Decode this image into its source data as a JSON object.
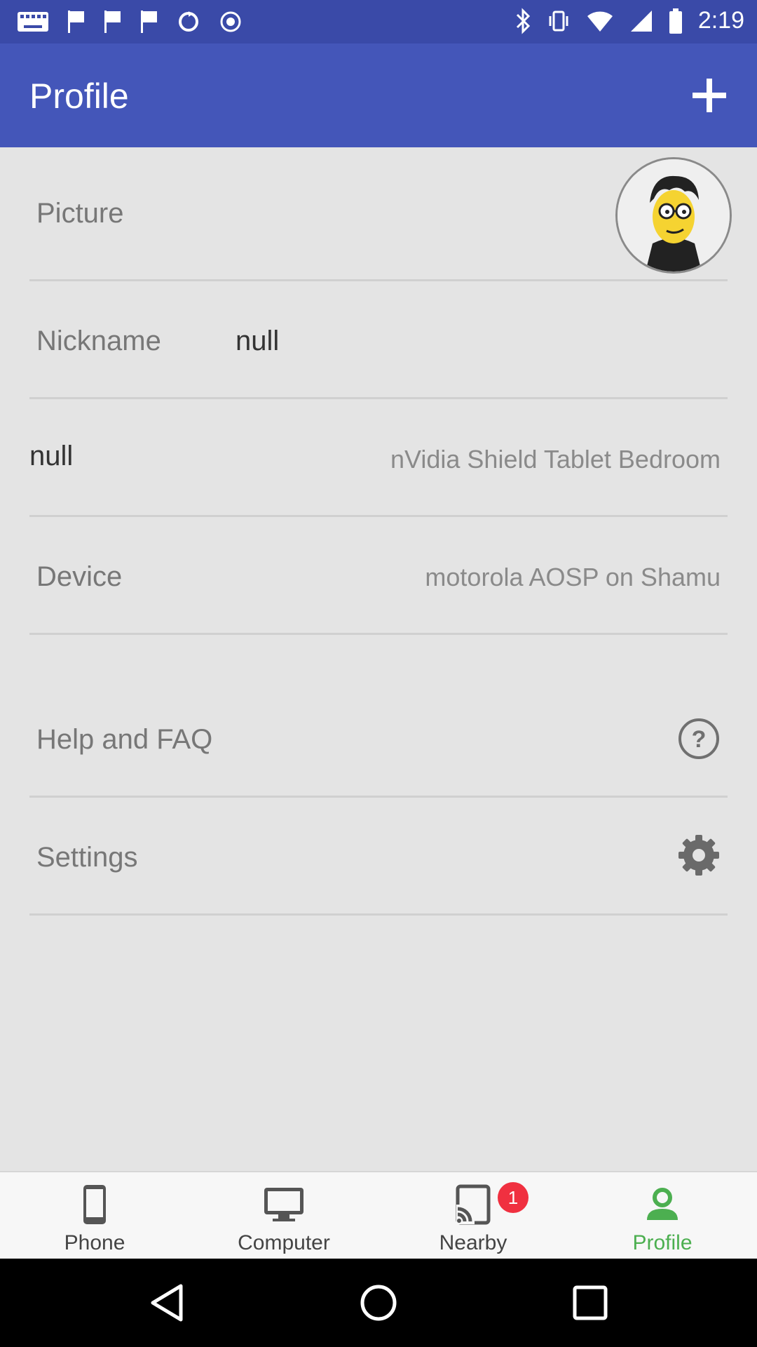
{
  "status_bar": {
    "time": "2:19",
    "icons": [
      "keyboard-icon",
      "flag-icon",
      "flag-icon",
      "flag-icon",
      "sync-icon",
      "circle-icon",
      "bluetooth-icon",
      "vibrate-icon",
      "wifi-icon",
      "signal-icon",
      "battery-icon"
    ]
  },
  "header": {
    "title": "Profile",
    "add_icon": "plus-icon"
  },
  "rows": {
    "picture": {
      "label": "Picture"
    },
    "nickname": {
      "label": "Nickname",
      "value": "null"
    },
    "name": {
      "label": "null",
      "value": "nVidia Shield Tablet Bedroom"
    },
    "device": {
      "label": "Device",
      "value": "motorola AOSP on Shamu"
    },
    "help": {
      "label": "Help and FAQ",
      "icon": "help-icon"
    },
    "settings": {
      "label": "Settings",
      "icon": "gear-icon"
    }
  },
  "bottom_nav": {
    "phone": {
      "label": "Phone",
      "icon": "phone-icon"
    },
    "computer": {
      "label": "Computer",
      "icon": "monitor-icon"
    },
    "nearby": {
      "label": "Nearby",
      "icon": "cast-icon",
      "badge": "1"
    },
    "profile": {
      "label": "Profile",
      "icon": "person-icon",
      "active": true
    }
  },
  "colors": {
    "app_bar": "#4456b9",
    "status_bar": "#3a4aa8",
    "active": "#4caf50",
    "badge": "#f03040"
  }
}
